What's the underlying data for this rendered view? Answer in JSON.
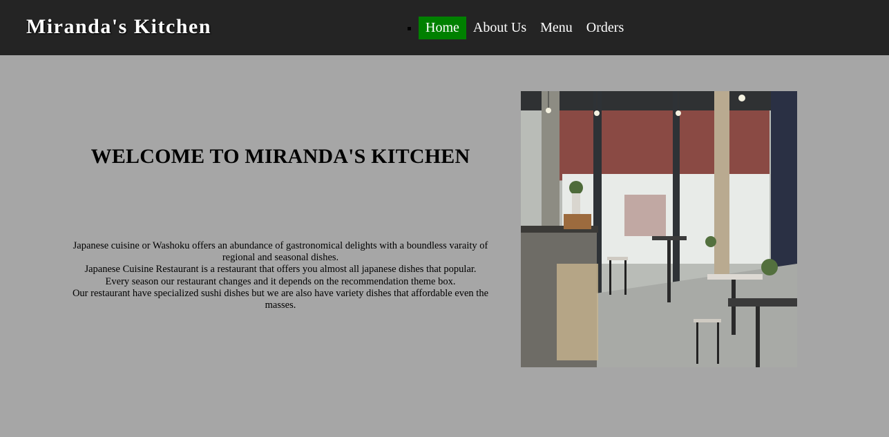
{
  "header": {
    "brand": "Miranda's Kitchen",
    "nav": [
      {
        "label": "Home",
        "active": true
      },
      {
        "label": "About Us",
        "active": false
      },
      {
        "label": "Menu",
        "active": false
      },
      {
        "label": "Orders",
        "active": false
      }
    ]
  },
  "main": {
    "heading": "WELCOME TO MIRANDA'S KITCHEN",
    "paragraphs": [
      "Japanese cuisine or Washoku offers an abundance of gastronomical delights with a boundless varaity of regional and seasonal dishes.",
      "Japanese Cuisine Restaurant is a restaurant that offers you almost all japanese dishes that popular.",
      "Every season our restaurant changes and it depends on the recommendation theme box.",
      "Our restaurant have specialized sushi dishes but we are also have variety dishes that affordable even the masses."
    ],
    "image": {
      "subject": "restaurant-interior-photo"
    }
  },
  "colors": {
    "header_bg": "#242424",
    "page_bg": "#a6a6a6",
    "nav_active_bg": "#008000",
    "nav_text": "#ffffff"
  }
}
